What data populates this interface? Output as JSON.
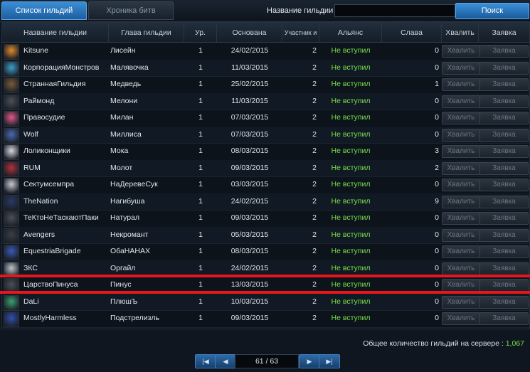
{
  "tabs": [
    {
      "label": "Список гильдий",
      "active": true
    },
    {
      "label": "Хроника битв",
      "active": false
    }
  ],
  "search": {
    "label": "Название гильдии",
    "value": "",
    "button": "Поиск"
  },
  "columns": [
    "Название гильдии",
    "Глава гильдии",
    "Ур.",
    "Основана",
    "Участник и",
    "Альянс",
    "Слава",
    "Хвалить",
    "Заявка"
  ],
  "row_buttons": {
    "praise": "Хвалить",
    "apply": "Заявка"
  },
  "rows": [
    {
      "name": "Kitsune",
      "leader": "Лисейн",
      "level": "1",
      "founded": "24/02/2015",
      "members": "2",
      "alliance": "Не вступил",
      "glory": "0",
      "emblem": "fox-emblem",
      "color": "#e08a2a"
    },
    {
      "name": "КорпорацияМонстров",
      "leader": "Малявочка",
      "level": "1",
      "founded": "11/03/2015",
      "members": "2",
      "alliance": "Не вступил",
      "glory": "0",
      "emblem": "monster-emblem",
      "color": "#3aa0c8"
    },
    {
      "name": "СтраннаяГильдия",
      "leader": "Медведь",
      "level": "1",
      "founded": "25/02/2015",
      "members": "2",
      "alliance": "Не вступил",
      "glory": "1",
      "emblem": "bear-emblem",
      "color": "#7a5a3a"
    },
    {
      "name": "Раймонд",
      "leader": "Мелони",
      "level": "1",
      "founded": "11/03/2015",
      "members": "2",
      "alliance": "Не вступил",
      "glory": "0",
      "emblem": "shield-emblem",
      "color": "#4a4f58"
    },
    {
      "name": "Правосудие",
      "leader": "Милан",
      "level": "1",
      "founded": "07/03/2015",
      "members": "2",
      "alliance": "Не вступил",
      "glory": "0",
      "emblem": "pink-emblem",
      "color": "#e05a8a"
    },
    {
      "name": "Wolf",
      "leader": "Миллиса",
      "level": "1",
      "founded": "07/03/2015",
      "members": "2",
      "alliance": "Не вступил",
      "glory": "0",
      "emblem": "wolf-emblem",
      "color": "#4a6ab0"
    },
    {
      "name": "Лоликонщики",
      "leader": "Мока",
      "level": "1",
      "founded": "08/03/2015",
      "members": "2",
      "alliance": "Не вступил",
      "glory": "3",
      "emblem": "anime-emblem",
      "color": "#d8d8e0"
    },
    {
      "name": "RUM",
      "leader": "Молот",
      "level": "1",
      "founded": "09/03/2015",
      "members": "2",
      "alliance": "Не вступил",
      "glory": "2",
      "emblem": "rum-emblem",
      "color": "#b0303a"
    },
    {
      "name": "Сектумсемпра",
      "leader": "НаДеревеСук",
      "level": "1",
      "founded": "03/03/2015",
      "members": "2",
      "alliance": "Не вступил",
      "glory": "0",
      "emblem": "bird-emblem",
      "color": "#c8c8d0"
    },
    {
      "name": "TheNation",
      "leader": "Нагибуша",
      "level": "1",
      "founded": "24/02/2015",
      "members": "2",
      "alliance": "Не вступил",
      "glory": "9",
      "emblem": "n-emblem",
      "color": "#2a3a6a"
    },
    {
      "name": "ТеКтоНеТаскаютПаки",
      "leader": "Натурал",
      "level": "1",
      "founded": "09/03/2015",
      "members": "2",
      "alliance": "Не вступил",
      "glory": "0",
      "emblem": "shield-emblem",
      "color": "#4a4f58"
    },
    {
      "name": "Avengers",
      "leader": "Некромант",
      "level": "1",
      "founded": "05/03/2015",
      "members": "2",
      "alliance": "Не вступил",
      "glory": "0",
      "emblem": "crest-emblem",
      "color": "#3a3f48"
    },
    {
      "name": "EquestriaBrigade",
      "leader": "ОбаНАНАХ",
      "level": "1",
      "founded": "08/03/2015",
      "members": "2",
      "alliance": "Не вступил",
      "glory": "0",
      "emblem": "pony-emblem",
      "color": "#3a5ab8"
    },
    {
      "name": "ЗКС",
      "leader": "Оргайл",
      "level": "1",
      "founded": "24/02/2015",
      "members": "2",
      "alliance": "Не вступил",
      "glory": "0",
      "emblem": "gear-emblem",
      "color": "#c0c4ca"
    },
    {
      "name": "ЦарствоПинуса",
      "leader": "Пинус",
      "level": "1",
      "founded": "13/03/2015",
      "members": "2",
      "alliance": "Не вступил",
      "glory": "0",
      "emblem": "shield-emblem",
      "color": "#4a4f58"
    },
    {
      "name": "DaLi",
      "leader": "ПлюшЪ",
      "level": "1",
      "founded": "10/03/2015",
      "members": "2",
      "alliance": "Не вступил",
      "glory": "0",
      "emblem": "green-emblem",
      "color": "#3aa070"
    },
    {
      "name": "MostlyHarmless",
      "leader": "Подстрелизль",
      "level": "1",
      "founded": "09/03/2015",
      "members": "2",
      "alliance": "Не вступил",
      "glory": "0",
      "emblem": "wing-emblem",
      "color": "#3050b0"
    }
  ],
  "footer": {
    "total_label": "Общее количество гильдий на сервере :",
    "total_value": "1,067"
  },
  "pager": {
    "page_text": "61 / 63",
    "first": "|◀",
    "prev": "◀",
    "next": "▶",
    "last": "▶|"
  }
}
